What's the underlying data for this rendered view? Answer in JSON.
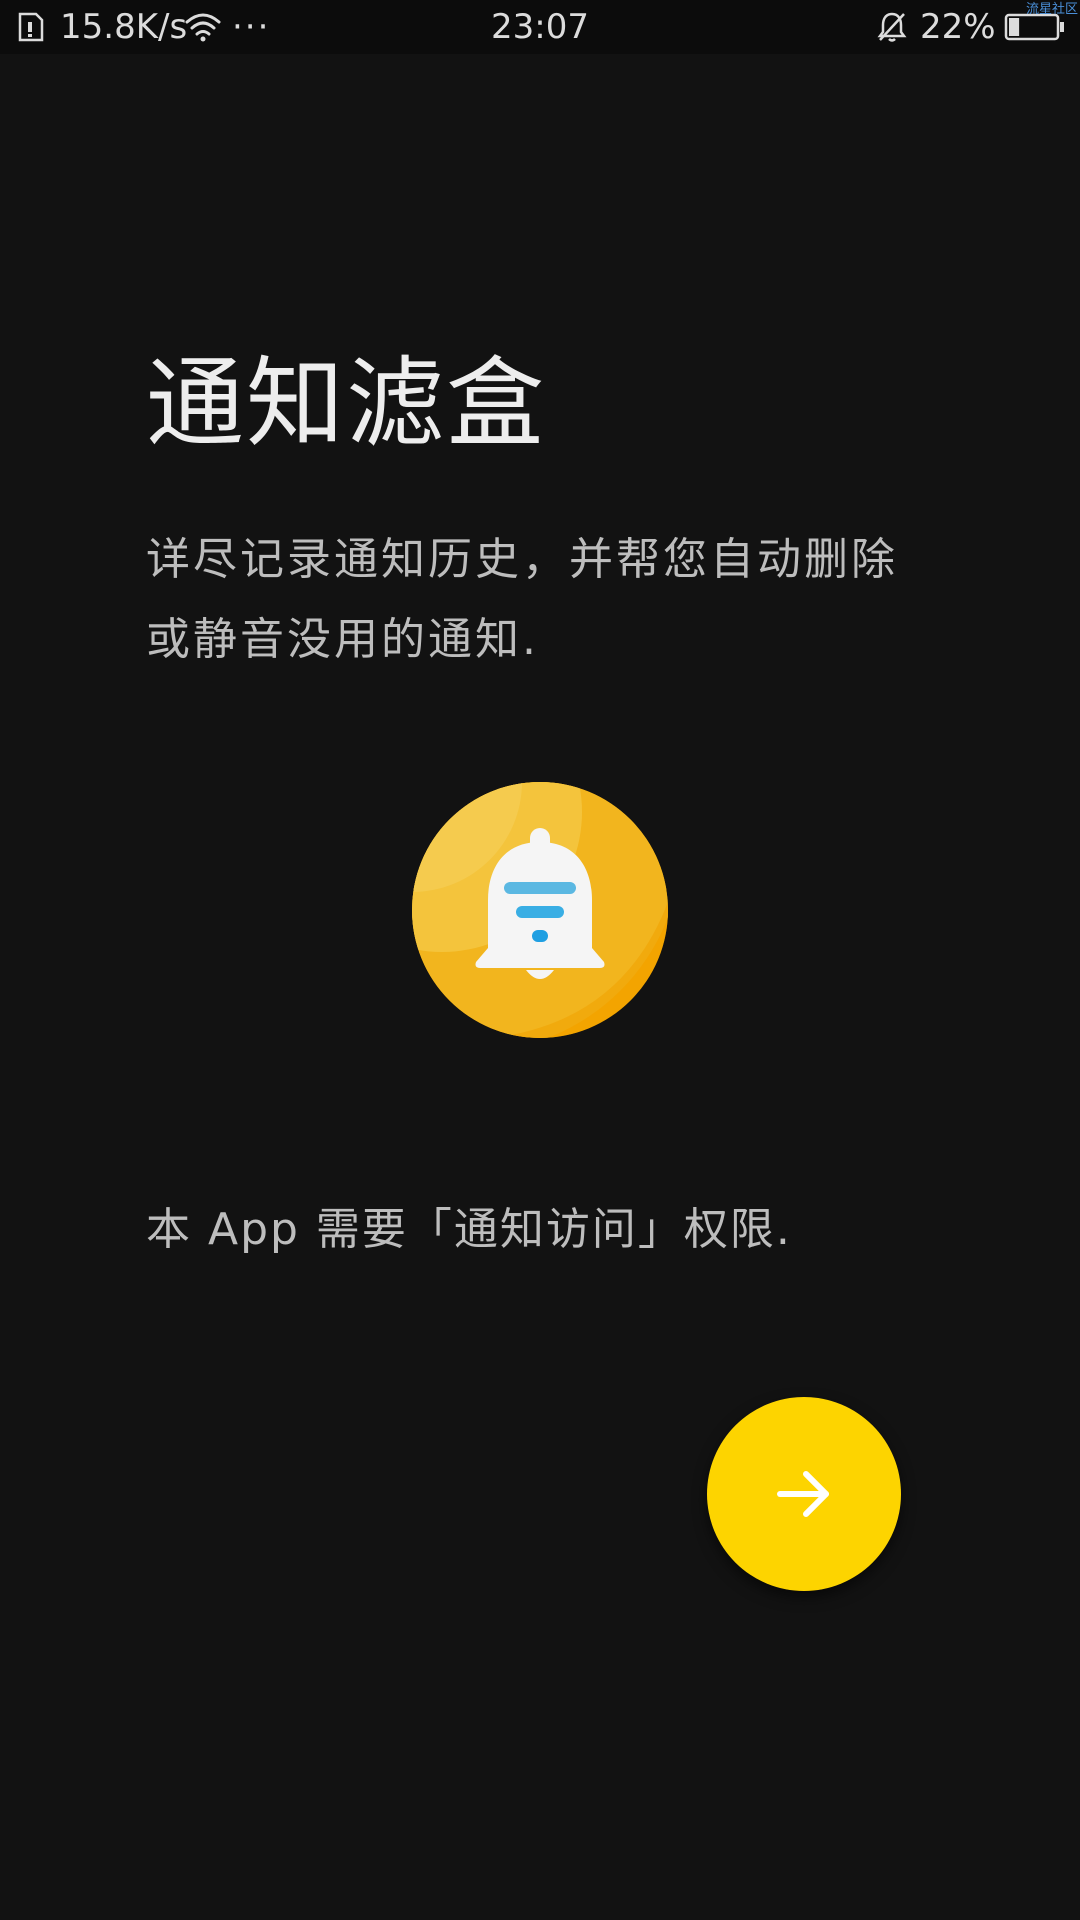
{
  "status_bar": {
    "network_speed": "15.8K/s",
    "more_indicator": "···",
    "time": "23:07",
    "battery_percent": "22%",
    "battery_level": 0.22,
    "watermark": "流星社区"
  },
  "welcome": {
    "title": "通知滤盒",
    "description_line1": "详尽记录通知历史，并帮您自动删除",
    "description_line2": "或静音没用的通知.",
    "permission_note": "本 App 需要「通知访问」权限."
  },
  "icons": {
    "app_icon": "bell-filter-icon",
    "next": "arrow-right-icon"
  },
  "colors": {
    "background": "#121212",
    "accent_yellow": "#fdd400",
    "icon_orange": "#f2a900",
    "filter_blue": "#29a9e6"
  }
}
